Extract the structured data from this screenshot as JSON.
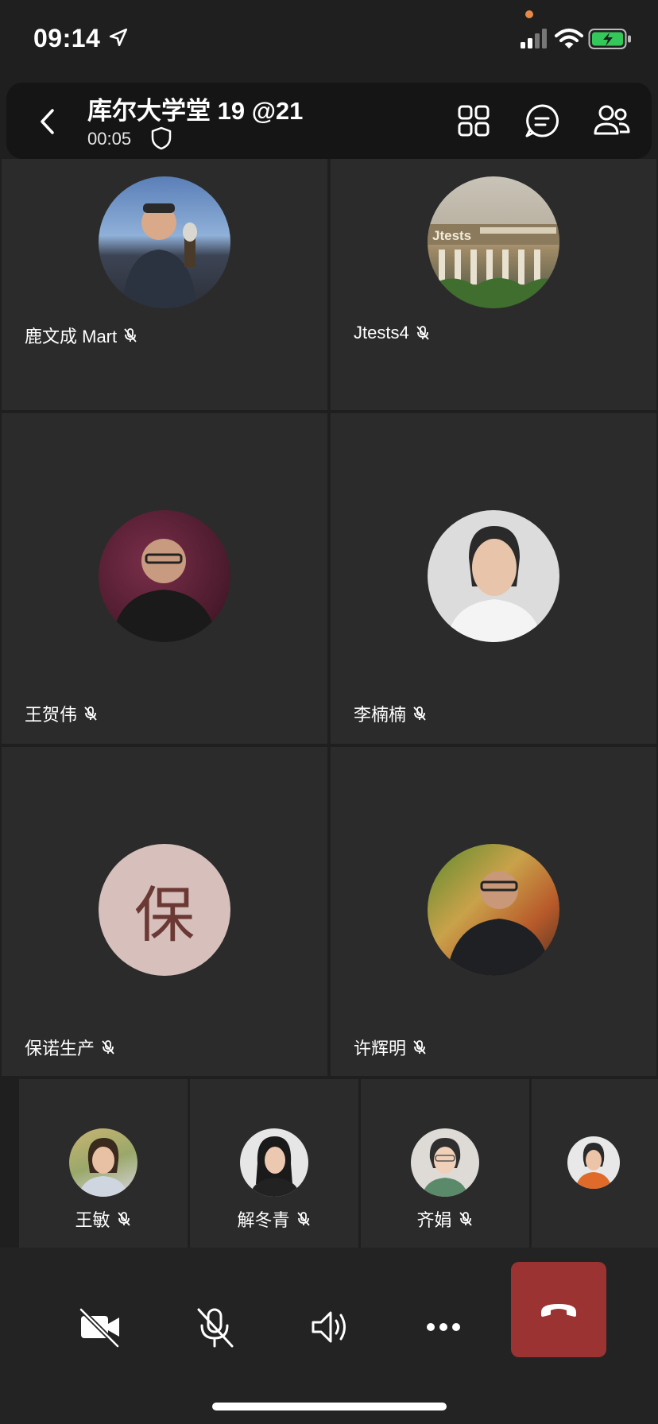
{
  "status_bar": {
    "time": "09:14"
  },
  "header": {
    "title": "库尔大学堂 19 @21",
    "timer": "00:05"
  },
  "tiles": [
    {
      "name": "鹿文成 Mart",
      "avatar": "photo"
    },
    {
      "name": "Jtests4",
      "avatar": "photo"
    },
    {
      "name": "王贺伟",
      "avatar": "photo"
    },
    {
      "name": "李楠楠",
      "avatar": "photo"
    },
    {
      "name": "保诺生产",
      "avatar": "initial",
      "initial": "保",
      "avatar_bg": "#d7bfbc",
      "avatar_fg": "#6b3934"
    },
    {
      "name": "许辉明",
      "avatar": "photo"
    }
  ],
  "strip": [
    {
      "name": "王敏"
    },
    {
      "name": "解冬青"
    },
    {
      "name": "齐娟"
    },
    {
      "name": ""
    }
  ],
  "controls": [
    {
      "icon": "camera-off-icon"
    },
    {
      "icon": "mic-off-icon"
    },
    {
      "icon": "speaker-icon"
    },
    {
      "icon": "more-icon"
    },
    {
      "icon": "hang-up-icon",
      "color": "#9a3331"
    }
  ],
  "colors": {
    "background": "#1f1f1f",
    "tile": "#2b2b2b",
    "header": "#151515",
    "hangup": "#9a3331",
    "battery": "#34c759"
  }
}
